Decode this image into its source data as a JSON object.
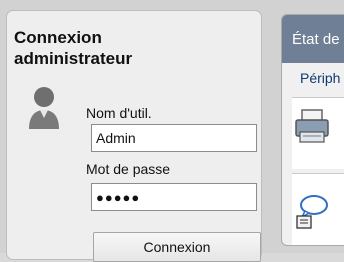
{
  "login": {
    "title": "Connexion administrateur",
    "username_label": "Nom d'util.",
    "username_value": "Admin",
    "password_label": "Mot de passe",
    "password_value": "●●●●●",
    "submit_label": "Connexion"
  },
  "status_panel": {
    "header_label": "État de",
    "section_label": "Périph"
  },
  "colors": {
    "panel_header": "#6f7f96",
    "link_text": "#0e3a72",
    "background": "#d2d2d2"
  },
  "icons": [
    "user-avatar-icon",
    "printer-icon",
    "chat-bubble-icon"
  ]
}
